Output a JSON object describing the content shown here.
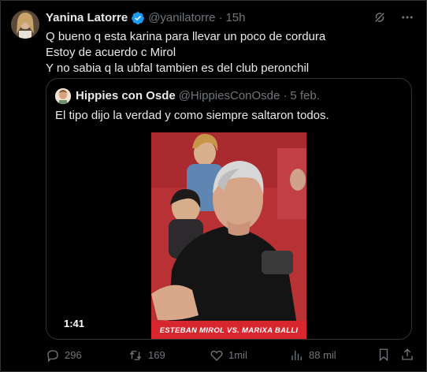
{
  "author": {
    "name": "Yanina Latorre",
    "handle": "@yanilatorre",
    "separator": "·",
    "time": "15h"
  },
  "tweet": {
    "lines": [
      "Q bueno q esta karina para llevar un poco de cordura",
      "Estoy de acuerdo c Mirol",
      "Y no sabia q la ubfal tambien es del club peronchil"
    ]
  },
  "quoted": {
    "name": "Hippies con Osde",
    "handle": "@HippiesConOsde",
    "separator": "·",
    "date": "5 feb.",
    "text": "El tipo dijo la verdad y como siempre saltaron todos.",
    "video": {
      "duration": "1:41",
      "caption": "ESTEBAN MIROL VS. MARIXA BALLI"
    }
  },
  "actions": {
    "replies": "296",
    "retweets": "169",
    "likes": "1mil",
    "views": "88 mil"
  },
  "colors": {
    "background": "#000000",
    "text": "#e7e9ea",
    "muted": "#71767b",
    "border": "#2f3336",
    "verified": "#1d9bf0",
    "caption_red": "#d8262e"
  },
  "icons": {
    "top": [
      "grok-icon",
      "more-icon"
    ],
    "actions": [
      "reply-icon",
      "retweet-icon",
      "like-icon",
      "views-icon",
      "bookmark-icon",
      "share-icon"
    ]
  }
}
